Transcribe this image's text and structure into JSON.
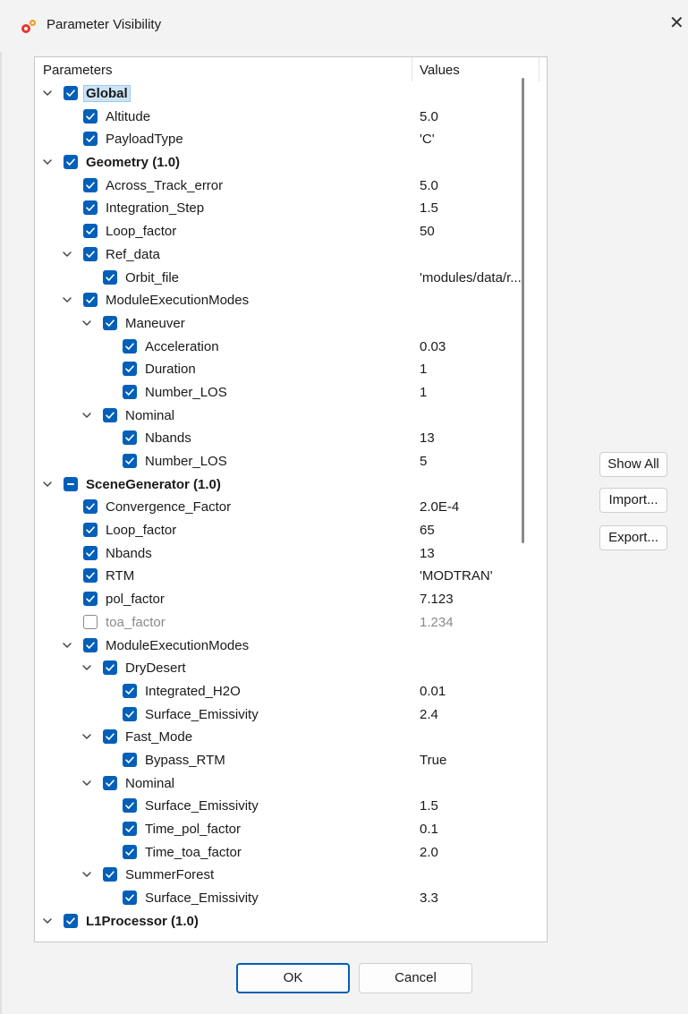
{
  "window": {
    "title": "Parameter Visibility",
    "icon": "gears-icon",
    "accent": "#005fb8"
  },
  "tree": {
    "columns": {
      "parameters": "Parameters",
      "values": "Values"
    },
    "rows": [
      {
        "level": 0,
        "label": "Global",
        "value": "",
        "state": "checked",
        "expand": "expanded",
        "bold": true,
        "selected": true
      },
      {
        "level": 1,
        "label": "Altitude",
        "value": "5.0",
        "state": "checked",
        "expand": "none"
      },
      {
        "level": 1,
        "label": "PayloadType",
        "value": "'C'",
        "state": "checked",
        "expand": "none"
      },
      {
        "level": 0,
        "label": "Geometry (1.0)",
        "value": "",
        "state": "checked",
        "expand": "expanded",
        "bold": true
      },
      {
        "level": 1,
        "label": "Across_Track_error",
        "value": "5.0",
        "state": "checked",
        "expand": "none"
      },
      {
        "level": 1,
        "label": "Integration_Step",
        "value": "1.5",
        "state": "checked",
        "expand": "none"
      },
      {
        "level": 1,
        "label": "Loop_factor",
        "value": "50",
        "state": "checked",
        "expand": "none"
      },
      {
        "level": 1,
        "label": "Ref_data",
        "value": "",
        "state": "checked",
        "expand": "expanded"
      },
      {
        "level": 2,
        "label": "Orbit_file",
        "value": "'modules/data/r...",
        "state": "checked",
        "expand": "none"
      },
      {
        "level": 1,
        "label": "ModuleExecutionModes",
        "value": "",
        "state": "checked",
        "expand": "expanded"
      },
      {
        "level": 2,
        "label": "Maneuver",
        "value": "",
        "state": "checked",
        "expand": "expanded"
      },
      {
        "level": 3,
        "label": "Acceleration",
        "value": "0.03",
        "state": "checked",
        "expand": "none"
      },
      {
        "level": 3,
        "label": "Duration",
        "value": "1",
        "state": "checked",
        "expand": "none"
      },
      {
        "level": 3,
        "label": "Number_LOS",
        "value": "1",
        "state": "checked",
        "expand": "none"
      },
      {
        "level": 2,
        "label": "Nominal",
        "value": "",
        "state": "checked",
        "expand": "expanded"
      },
      {
        "level": 3,
        "label": "Nbands",
        "value": "13",
        "state": "checked",
        "expand": "none"
      },
      {
        "level": 3,
        "label": "Number_LOS",
        "value": "5",
        "state": "checked",
        "expand": "none"
      },
      {
        "level": 0,
        "label": "SceneGenerator (1.0)",
        "value": "",
        "state": "partial",
        "expand": "expanded",
        "bold": true
      },
      {
        "level": 1,
        "label": "Convergence_Factor",
        "value": "2.0E-4",
        "state": "checked",
        "expand": "none"
      },
      {
        "level": 1,
        "label": "Loop_factor",
        "value": "65",
        "state": "checked",
        "expand": "none"
      },
      {
        "level": 1,
        "label": "Nbands",
        "value": "13",
        "state": "checked",
        "expand": "none"
      },
      {
        "level": 1,
        "label": "RTM",
        "value": "'MODTRAN'",
        "state": "checked",
        "expand": "none"
      },
      {
        "level": 1,
        "label": "pol_factor",
        "value": "7.123",
        "state": "checked",
        "expand": "none"
      },
      {
        "level": 1,
        "label": "toa_factor",
        "value": "1.234",
        "state": "unchecked",
        "expand": "none"
      },
      {
        "level": 1,
        "label": "ModuleExecutionModes",
        "value": "",
        "state": "checked",
        "expand": "expanded"
      },
      {
        "level": 2,
        "label": "DryDesert",
        "value": "",
        "state": "checked",
        "expand": "expanded"
      },
      {
        "level": 3,
        "label": "Integrated_H2O",
        "value": "0.01",
        "state": "checked",
        "expand": "none"
      },
      {
        "level": 3,
        "label": "Surface_Emissivity",
        "value": "2.4",
        "state": "checked",
        "expand": "none"
      },
      {
        "level": 2,
        "label": "Fast_Mode",
        "value": "",
        "state": "checked",
        "expand": "expanded"
      },
      {
        "level": 3,
        "label": "Bypass_RTM",
        "value": "True",
        "state": "checked",
        "expand": "none"
      },
      {
        "level": 2,
        "label": "Nominal",
        "value": "",
        "state": "checked",
        "expand": "expanded"
      },
      {
        "level": 3,
        "label": "Surface_Emissivity",
        "value": "1.5",
        "state": "checked",
        "expand": "none"
      },
      {
        "level": 3,
        "label": "Time_pol_factor",
        "value": "0.1",
        "state": "checked",
        "expand": "none"
      },
      {
        "level": 3,
        "label": "Time_toa_factor",
        "value": "2.0",
        "state": "checked",
        "expand": "none"
      },
      {
        "level": 2,
        "label": "SummerForest",
        "value": "",
        "state": "checked",
        "expand": "expanded"
      },
      {
        "level": 3,
        "label": "Surface_Emissivity",
        "value": "3.3",
        "state": "checked",
        "expand": "none"
      },
      {
        "level": 0,
        "label": "L1Processor (1.0)",
        "value": "",
        "state": "checked",
        "expand": "expanded",
        "bold": true
      }
    ]
  },
  "side_buttons": {
    "show_all": "Show All",
    "import": "Import...",
    "export": "Export..."
  },
  "footer": {
    "ok": "OK",
    "cancel": "Cancel"
  }
}
